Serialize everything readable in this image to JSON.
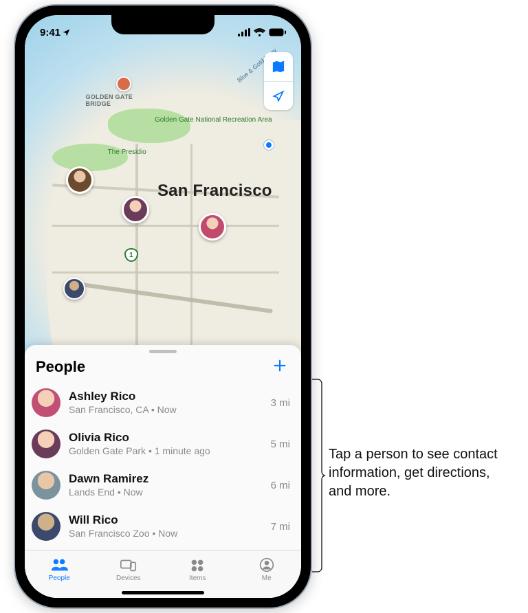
{
  "status": {
    "time": "9:41"
  },
  "map": {
    "city_label": "San Francisco",
    "gg_bridge_label": "GOLDEN GATE\nBRIDGE",
    "presidio_label": "The Presidio",
    "ggnra_label": "Golden Gate\nNational\nRecreation Area",
    "ferry_label": "Blue & Gold Ferry",
    "hwy_shield": "1"
  },
  "sheet_title": "People",
  "people": [
    {
      "name": "Ashley Rico",
      "sub": "San Francisco, CA • Now",
      "dist": "3 mi"
    },
    {
      "name": "Olivia Rico",
      "sub": "Golden Gate Park • 1 minute ago",
      "dist": "5 mi"
    },
    {
      "name": "Dawn Ramirez",
      "sub": "Lands End • Now",
      "dist": "6 mi"
    },
    {
      "name": "Will Rico",
      "sub": "San Francisco Zoo • Now",
      "dist": "7 mi"
    }
  ],
  "tabs": {
    "people": "People",
    "devices": "Devices",
    "items": "Items",
    "me": "Me"
  },
  "callout": "Tap a person to see contact information, get directions, and more."
}
